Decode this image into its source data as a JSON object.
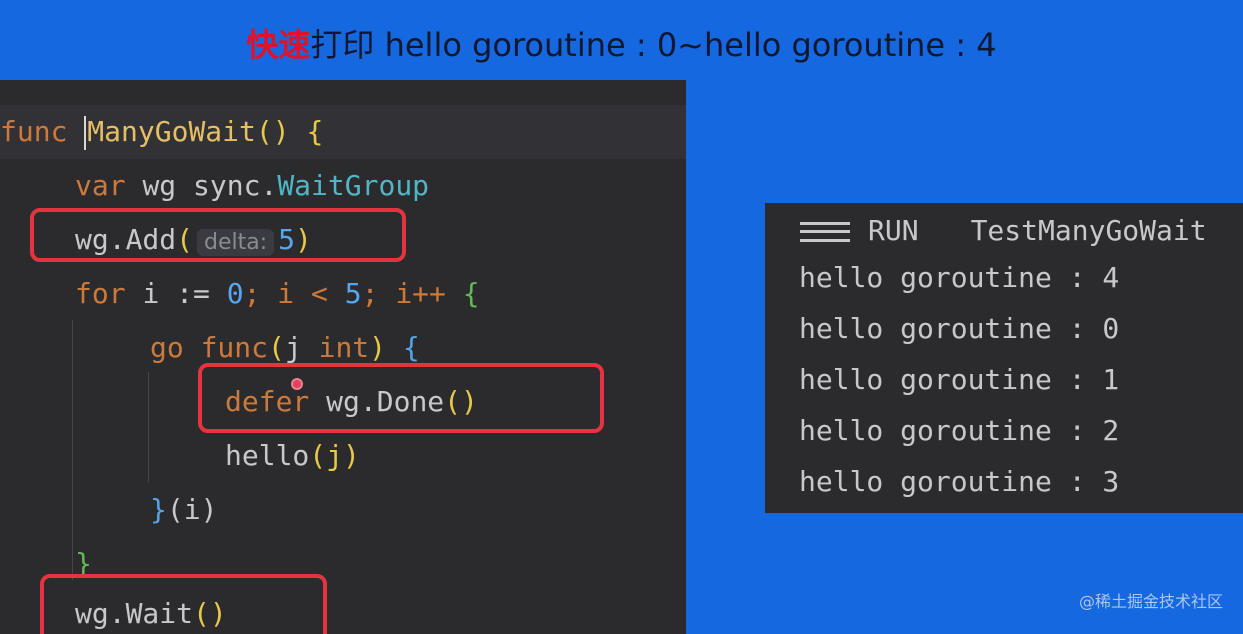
{
  "title": {
    "accent": "快速",
    "rest": "打印 hello goroutine : 0~hello goroutine : 4"
  },
  "code": {
    "l1": {
      "kw": "func",
      "name": "ManyGoWait",
      "parens": "()",
      "brace": "{"
    },
    "l2": {
      "kw": "var",
      "ident": "wg",
      "pkg": "sync.",
      "type": "WaitGroup"
    },
    "l3": {
      "recv": "wg.",
      "fn": "Add",
      "open": "(",
      "hint": "delta:",
      "num": "5",
      "close": ")"
    },
    "l4": {
      "kw": "for",
      "a": "i :=",
      "zero": "0",
      "b": "; i <",
      "five": "5",
      "c": "; i++",
      "brace": "{"
    },
    "l5": {
      "kw1": "go",
      "kw2": "func",
      "open": "(",
      "param": "j",
      "ptype": "int",
      "close": ")",
      "brace": "{"
    },
    "l6": {
      "kw": "defer",
      "recv": "wg.",
      "fn": "Done",
      "parens": "()"
    },
    "l7": {
      "fn": "hello",
      "args": "(j)"
    },
    "l8": {
      "brace": "}",
      "args": "(i)"
    },
    "l9": {
      "brace": "}"
    },
    "l10": {
      "recv": "wg.",
      "fn": "Wait",
      "parens": "()"
    }
  },
  "run_panel": {
    "menu_icon": "menu-icon",
    "label": "RUN",
    "test_name": "TestManyGoWait",
    "output": [
      "hello goroutine : 4",
      "hello goroutine : 0",
      "hello goroutine : 1",
      "hello goroutine : 2",
      "hello goroutine : 3"
    ]
  },
  "watermark": "@稀土掘金技术社区",
  "colors": {
    "background": "#1668e0",
    "editor_bg": "#2b2b2e",
    "highlight_box": "#e5343f",
    "title_accent": "#e0122a"
  }
}
